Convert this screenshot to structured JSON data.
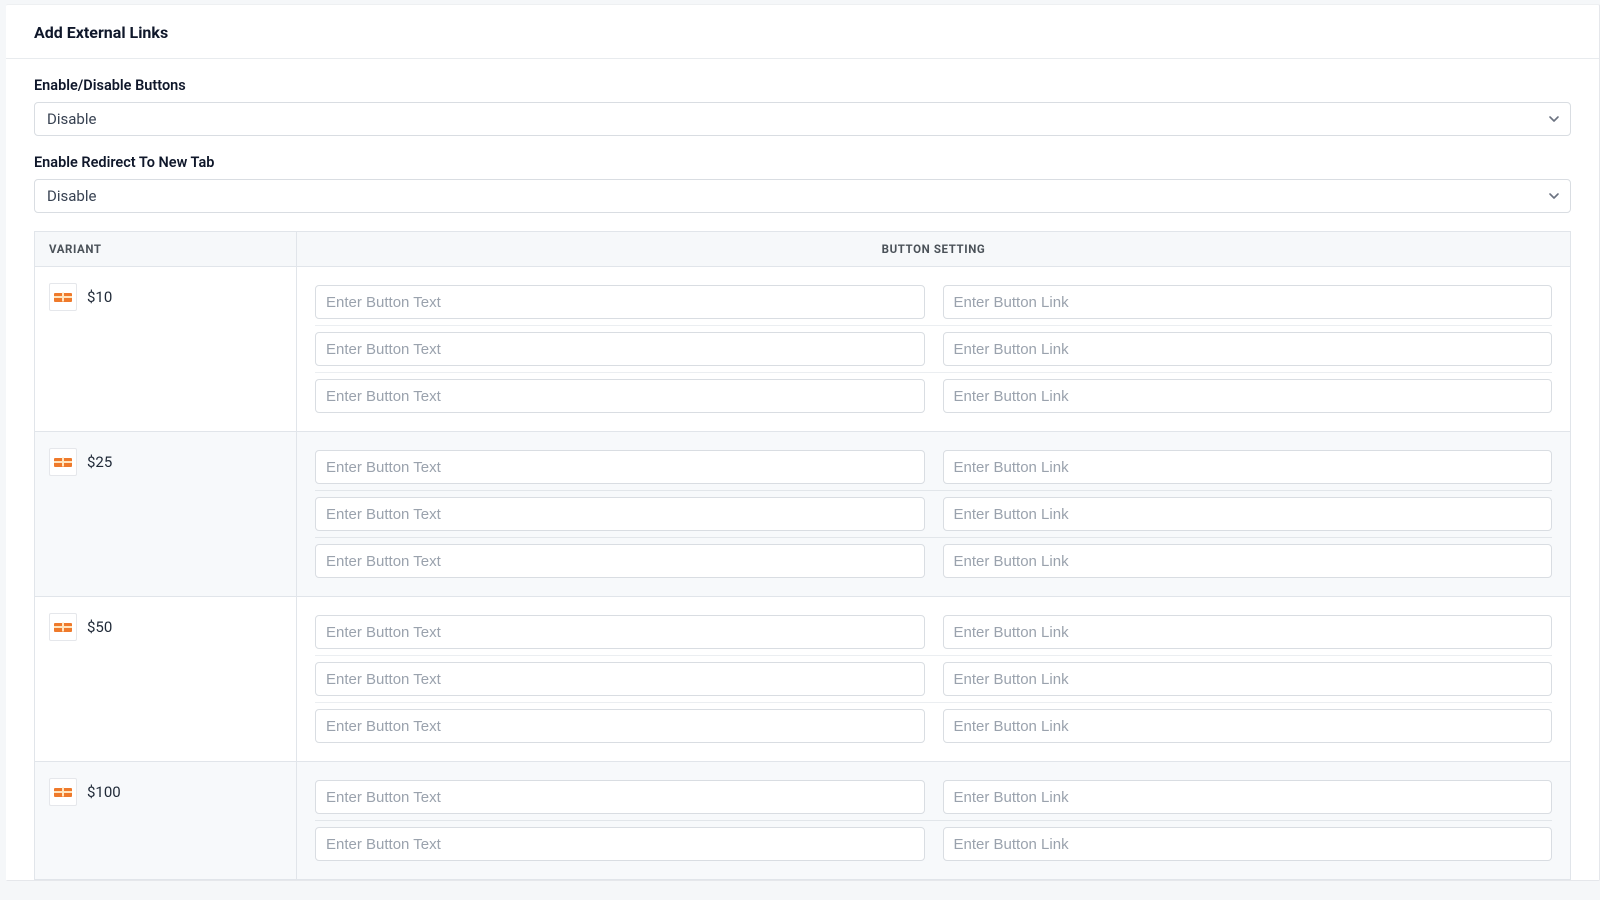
{
  "card": {
    "title": "Add External Links"
  },
  "form": {
    "enable_buttons_label": "Enable/Disable Buttons",
    "enable_buttons_value": "Disable",
    "redirect_label": "Enable Redirect To New Tab",
    "redirect_value": "Disable"
  },
  "table": {
    "col_variant": "Variant",
    "col_setting": "Button Setting",
    "placeholder_text": "Enter Button Text",
    "placeholder_link": "Enter Button Link",
    "variants": [
      {
        "name": "$10",
        "rows": 3
      },
      {
        "name": "$25",
        "rows": 3
      },
      {
        "name": "$50",
        "rows": 3
      },
      {
        "name": "$100",
        "rows": 2
      }
    ]
  }
}
